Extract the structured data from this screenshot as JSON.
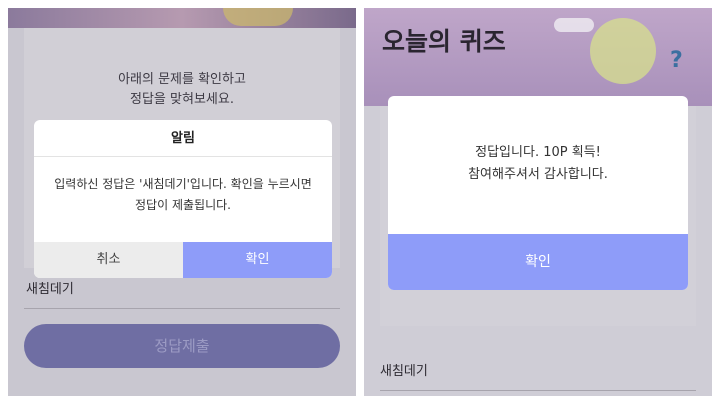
{
  "left": {
    "instructions_line1": "아래의 문제를 확인하고",
    "instructions_line2": "정답을 맞혀보세요.",
    "answer_text": "새침데기",
    "submit_label": "정답제출",
    "dialog": {
      "title": "알림",
      "message": "입력하신 정답은 '새침데기'입니다. 확인을 누르시면 정답이 제출됩니다.",
      "cancel_label": "취소",
      "confirm_label": "확인"
    }
  },
  "right": {
    "hero_title": "오늘의 퀴즈",
    "answer_text": "새침데기",
    "dialog": {
      "message_line1": "정답입니다. 10P 획득!",
      "message_line2": "참여해주셔서 감사합니다.",
      "confirm_label": "확인"
    }
  },
  "colors": {
    "accent": "#8e9cf9",
    "submit_disabled": "#6f6ea3"
  }
}
